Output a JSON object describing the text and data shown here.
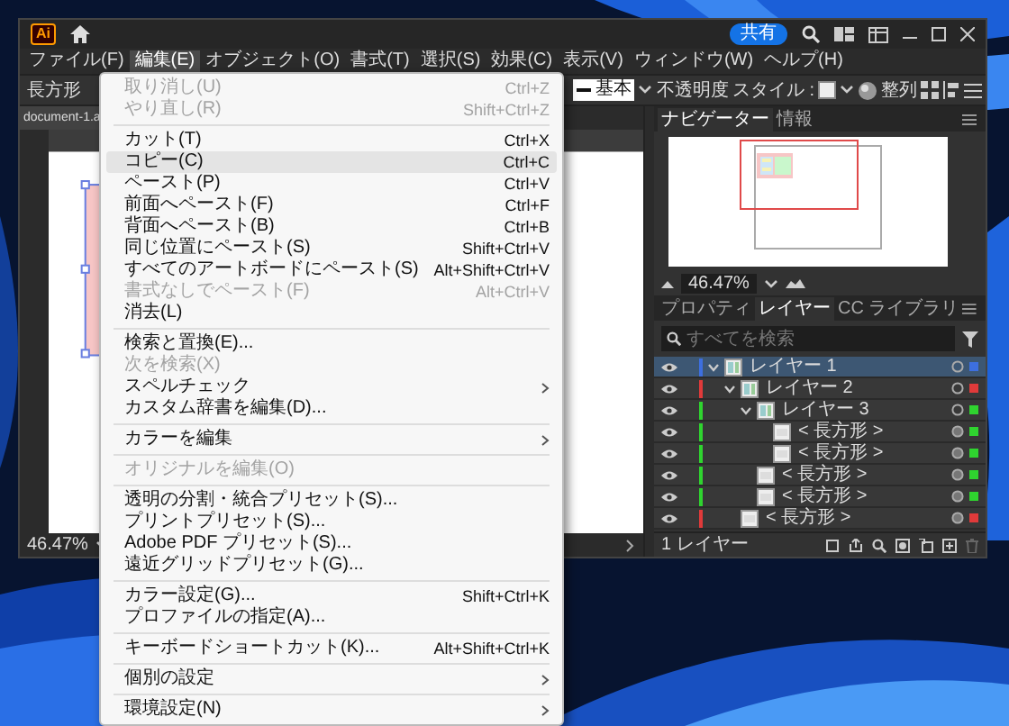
{
  "window": {
    "logo": "Ai",
    "share_button": "共有"
  },
  "menu_bar": [
    {
      "label": "ファイル(F)",
      "selected": false
    },
    {
      "label": "編集(E)",
      "selected": true
    },
    {
      "label": "オブジェクト(O)",
      "selected": false
    },
    {
      "label": "書式(T)",
      "selected": false
    },
    {
      "label": "選択(S)",
      "selected": false
    },
    {
      "label": "効果(C)",
      "selected": false
    },
    {
      "label": "表示(V)",
      "selected": false
    },
    {
      "label": "ウィンドウ(W)",
      "selected": false
    },
    {
      "label": "ヘルプ(H)",
      "selected": false
    }
  ],
  "control_bar": {
    "tool": "長方形",
    "stroke_style": "基本",
    "opacity_label": "不透明度",
    "style_label": "スタイル :",
    "align_button": "整列"
  },
  "document": {
    "tab": "document-1.a",
    "zoom": "46.47%"
  },
  "edit_menu": {
    "groups": [
      [
        {
          "label": "取り消し(U)",
          "shortcut": "Ctrl+Z",
          "disabled": true,
          "selected": false,
          "submenu": false
        },
        {
          "label": "やり直し(R)",
          "shortcut": "Shift+Ctrl+Z",
          "disabled": true,
          "selected": false,
          "submenu": false
        }
      ],
      [
        {
          "label": "カット(T)",
          "shortcut": "Ctrl+X",
          "disabled": false,
          "selected": false,
          "submenu": false
        },
        {
          "label": "コピー(C)",
          "shortcut": "Ctrl+C",
          "disabled": false,
          "selected": true,
          "submenu": false
        },
        {
          "label": "ペースト(P)",
          "shortcut": "Ctrl+V",
          "disabled": false,
          "selected": false,
          "submenu": false
        },
        {
          "label": "前面へペースト(F)",
          "shortcut": "Ctrl+F",
          "disabled": false,
          "selected": false,
          "submenu": false
        },
        {
          "label": "背面へペースト(B)",
          "shortcut": "Ctrl+B",
          "disabled": false,
          "selected": false,
          "submenu": false
        },
        {
          "label": "同じ位置にペースト(S)",
          "shortcut": "Shift+Ctrl+V",
          "disabled": false,
          "selected": false,
          "submenu": false
        },
        {
          "label": "すべてのアートボードにペースト(S)",
          "shortcut": "Alt+Shift+Ctrl+V",
          "disabled": false,
          "selected": false,
          "submenu": false
        },
        {
          "label": "書式なしでペースト(F)",
          "shortcut": "Alt+Ctrl+V",
          "disabled": true,
          "selected": false,
          "submenu": false
        },
        {
          "label": "消去(L)",
          "disabled": false,
          "selected": false,
          "submenu": false
        }
      ],
      [
        {
          "label": "検索と置換(E)...",
          "disabled": false,
          "selected": false,
          "submenu": false
        },
        {
          "label": "次を検索(X)",
          "disabled": true,
          "selected": false,
          "submenu": false
        },
        {
          "label": "スペルチェック",
          "disabled": false,
          "selected": false,
          "submenu": true
        },
        {
          "label": "カスタム辞書を編集(D)...",
          "disabled": false,
          "selected": false,
          "submenu": false
        }
      ],
      [
        {
          "label": "カラーを編集",
          "disabled": false,
          "selected": false,
          "submenu": true
        }
      ],
      [
        {
          "label": "オリジナルを編集(O)",
          "disabled": true,
          "selected": false,
          "submenu": false
        }
      ],
      [
        {
          "label": "透明の分割・統合プリセット(S)...",
          "disabled": false,
          "selected": false,
          "submenu": false
        },
        {
          "label": "プリントプリセット(S)...",
          "disabled": false,
          "selected": false,
          "submenu": false
        },
        {
          "label": "Adobe PDF プリセット(S)...",
          "disabled": false,
          "selected": false,
          "submenu": false
        },
        {
          "label": "遠近グリッドプリセット(G)...",
          "disabled": false,
          "selected": false,
          "submenu": false
        }
      ],
      [
        {
          "label": "カラー設定(G)...",
          "shortcut": "Shift+Ctrl+K",
          "disabled": false,
          "selected": false,
          "submenu": false
        },
        {
          "label": "プロファイルの指定(A)...",
          "disabled": false,
          "selected": false,
          "submenu": false
        }
      ],
      [
        {
          "label": "キーボードショートカット(K)...",
          "shortcut": "Alt+Shift+Ctrl+K",
          "disabled": false,
          "selected": false,
          "submenu": false
        }
      ],
      [
        {
          "label": "個別の設定",
          "disabled": false,
          "selected": false,
          "submenu": true
        }
      ],
      [
        {
          "label": "環境設定(N)",
          "disabled": false,
          "selected": false,
          "submenu": true
        }
      ]
    ]
  },
  "navigator": {
    "tabs": [
      {
        "label": "ナビゲーター",
        "selected": true
      },
      {
        "label": "情報",
        "selected": false
      }
    ],
    "zoom": "46.47%"
  },
  "layers_panel": {
    "tabs": [
      {
        "label": "プロパティ",
        "selected": false
      },
      {
        "label": "レイヤー",
        "selected": true
      },
      {
        "label": "CC ライブラリ",
        "selected": false
      }
    ],
    "search": {
      "placeholder": "すべてを検索"
    },
    "layers": [
      {
        "name": "レイヤー 1",
        "kind": "layer",
        "color": "#3d6fe0",
        "selected": true,
        "expanded": true,
        "children": [
          {
            "name": "レイヤー 2",
            "kind": "layer",
            "color": "#e03a3a",
            "selected": false,
            "expanded": true,
            "children": [
              {
                "name": "レイヤー 3",
                "kind": "layer",
                "color": "#2fd42f",
                "selected": false,
                "expanded": true,
                "children": [
                  {
                    "name": "< 長方形 >",
                    "kind": "path",
                    "color": "#2fd42f",
                    "selected": false
                  },
                  {
                    "name": "< 長方形 >",
                    "kind": "path",
                    "color": "#2fd42f",
                    "selected": false
                  }
                ]
              },
              {
                "name": "< 長方形 >",
                "kind": "path",
                "color": "#2fd42f",
                "selected": false
              },
              {
                "name": "< 長方形 >",
                "kind": "path",
                "color": "#2fd42f",
                "selected": false
              }
            ]
          },
          {
            "name": "< 長方形 >",
            "kind": "path",
            "color": "#e03a3a",
            "selected": false
          }
        ]
      }
    ],
    "footer": "1 レイヤー"
  }
}
